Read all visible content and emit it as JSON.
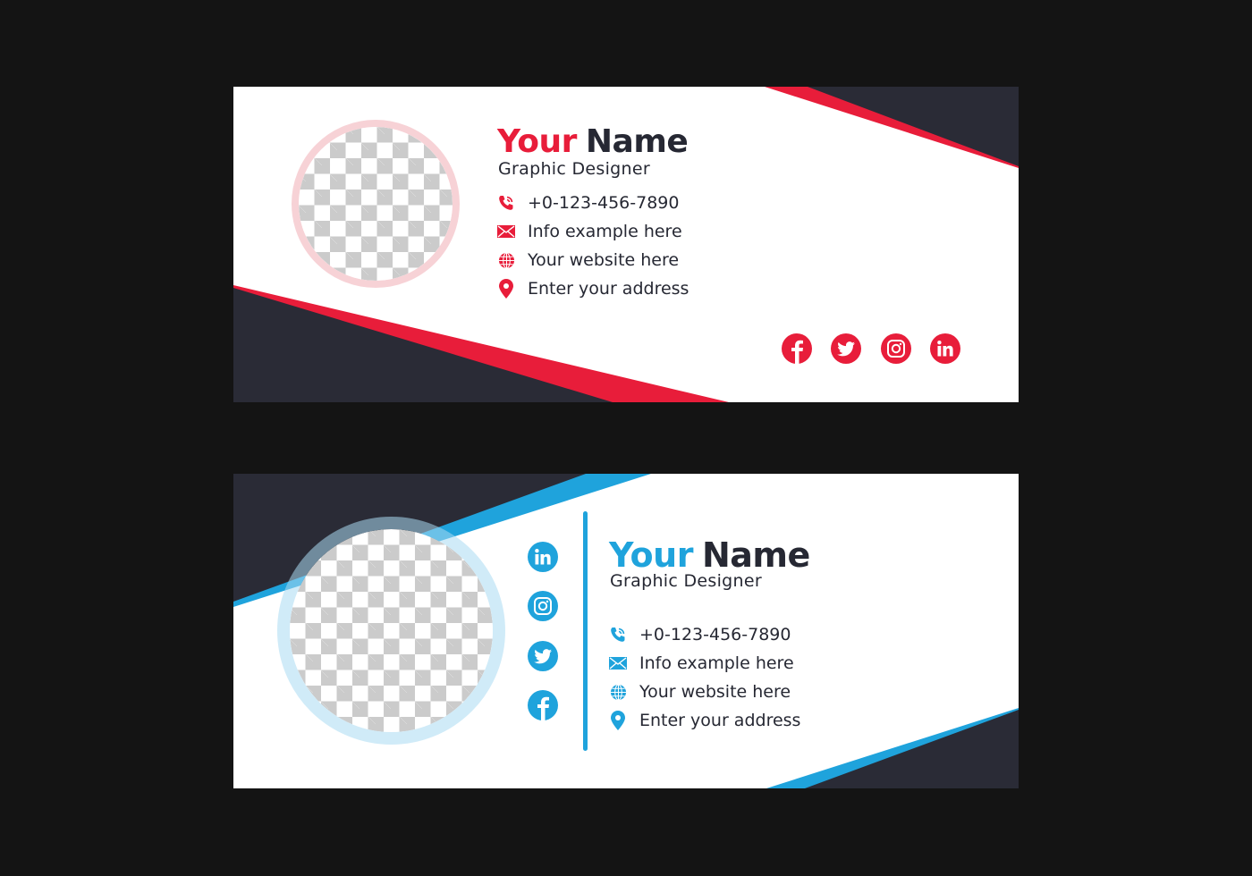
{
  "colors": {
    "background": "#141414",
    "card_background": "#ffffff",
    "dark_shape": "#2a2b36",
    "red_accent": "#e81d3a",
    "blue_accent": "#1fa3dc",
    "text_dark": "#262833",
    "red_ring": "#f7d2d6",
    "blue_ring": "#c8e6f6"
  },
  "cards": [
    {
      "theme": "red",
      "name_first": "Your",
      "name_last": "Name",
      "job_title": "Graphic Designer",
      "contacts": [
        {
          "icon": "phone-icon",
          "text": "+0-123-456-7890"
        },
        {
          "icon": "email-icon",
          "text": "Info example here"
        },
        {
          "icon": "globe-icon",
          "text": "Your website here"
        },
        {
          "icon": "location-pin-icon",
          "text": "Enter your address"
        }
      ],
      "social": [
        {
          "icon": "facebook-icon",
          "label": "Facebook"
        },
        {
          "icon": "twitter-icon",
          "label": "Twitter"
        },
        {
          "icon": "instagram-icon",
          "label": "Instagram"
        },
        {
          "icon": "linkedin-icon",
          "label": "LinkedIn"
        }
      ],
      "photo_placeholder": "transparent-checkerboard"
    },
    {
      "theme": "blue",
      "name_first": "Your",
      "name_last": "Name",
      "job_title": "Graphic Designer",
      "contacts": [
        {
          "icon": "phone-icon",
          "text": "+0-123-456-7890"
        },
        {
          "icon": "email-icon",
          "text": "Info example here"
        },
        {
          "icon": "globe-icon",
          "text": "Your website here"
        },
        {
          "icon": "location-pin-icon",
          "text": "Enter your address"
        }
      ],
      "social": [
        {
          "icon": "linkedin-icon",
          "label": "LinkedIn"
        },
        {
          "icon": "instagram-icon",
          "label": "Instagram"
        },
        {
          "icon": "twitter-icon",
          "label": "Twitter"
        },
        {
          "icon": "facebook-icon",
          "label": "Facebook"
        }
      ],
      "photo_placeholder": "transparent-checkerboard"
    }
  ]
}
